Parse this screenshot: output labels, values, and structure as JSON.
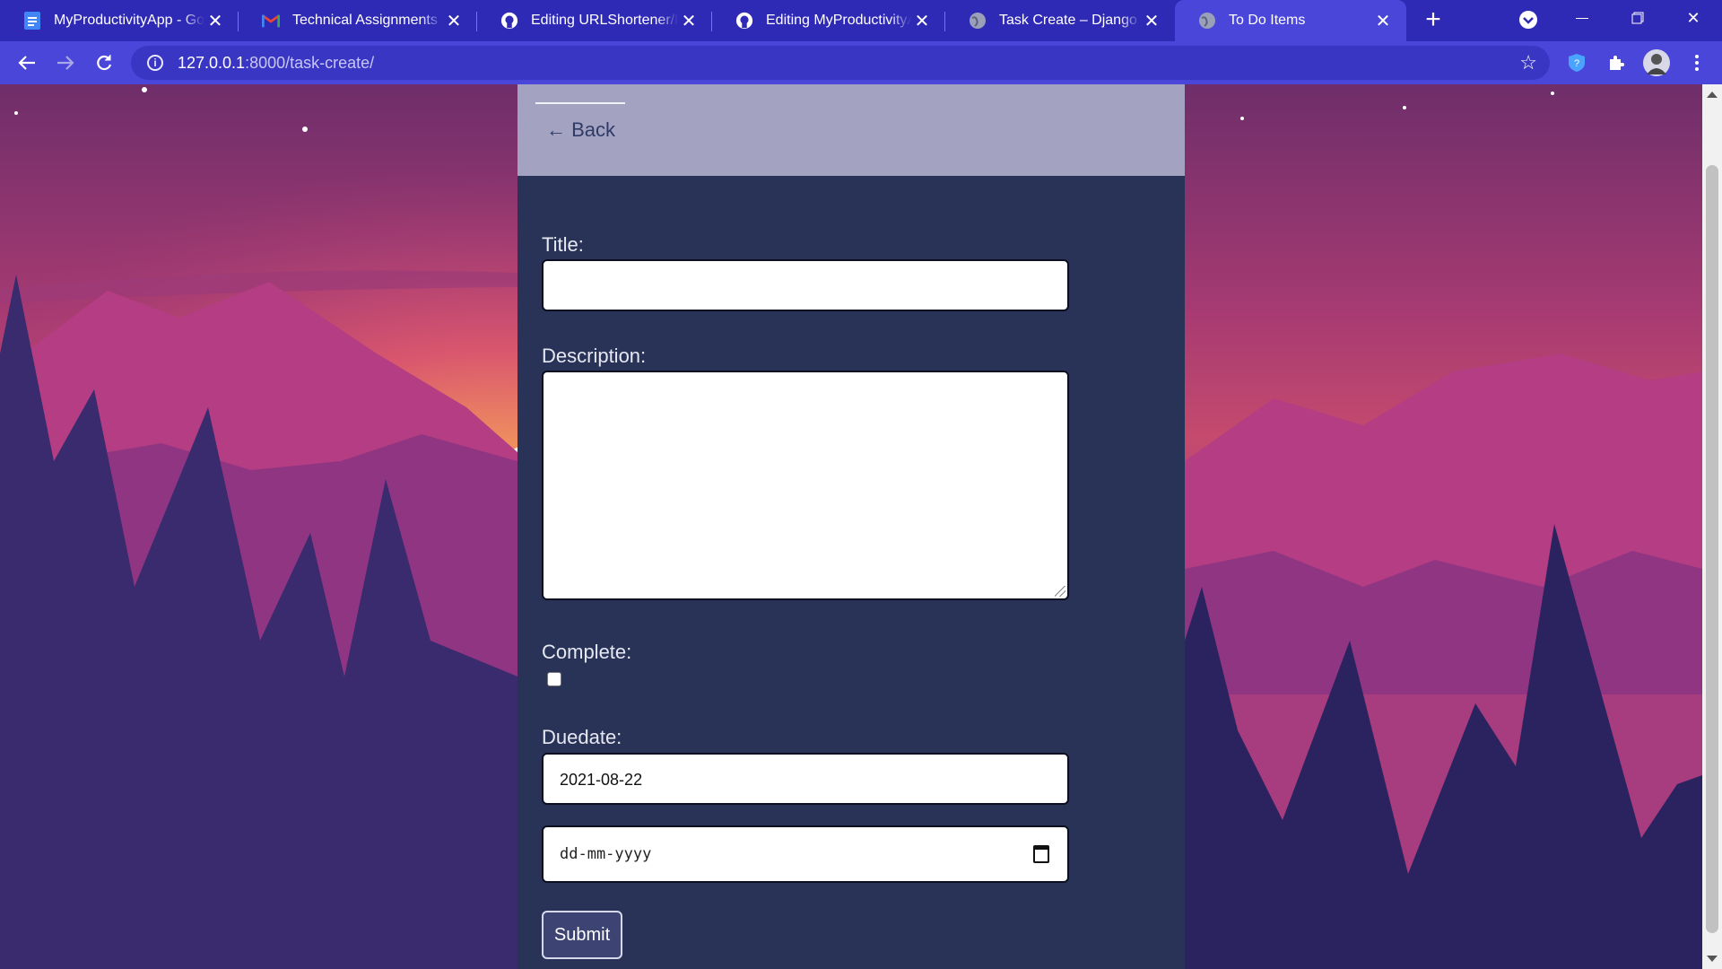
{
  "browser": {
    "tabs": [
      {
        "title": "MyProductivityApp - Go",
        "icon": "docs-icon",
        "active": false
      },
      {
        "title": "Technical Assignments fo",
        "icon": "gmail-icon",
        "active": false
      },
      {
        "title": "Editing URLShortener/R",
        "icon": "github-icon",
        "active": false
      },
      {
        "title": "Editing MyProductivityA",
        "icon": "github-icon",
        "active": false
      },
      {
        "title": "Task Create – Django RE",
        "icon": "globe-icon",
        "active": false
      },
      {
        "title": "To Do Items",
        "icon": "globe-icon",
        "active": true
      }
    ],
    "url_host": "127.0.0.1",
    "url_path": ":8000/task-create/"
  },
  "card": {
    "back_label": "← Back",
    "form": {
      "title_label": "Title:",
      "title_value": "",
      "description_label": "Description:",
      "description_value": "",
      "complete_label": "Complete:",
      "complete_checked": false,
      "duedate_label": "Duedate:",
      "duedate_value": "2021-08-22",
      "date_placeholder": "dd-mm-yyyy",
      "submit_label": "Submit"
    }
  },
  "colors": {
    "tabstrip": "#2f2ab5",
    "toolbar": "#4a46d9",
    "card_bg": "#293357",
    "card_header": "#a3a3c1"
  }
}
